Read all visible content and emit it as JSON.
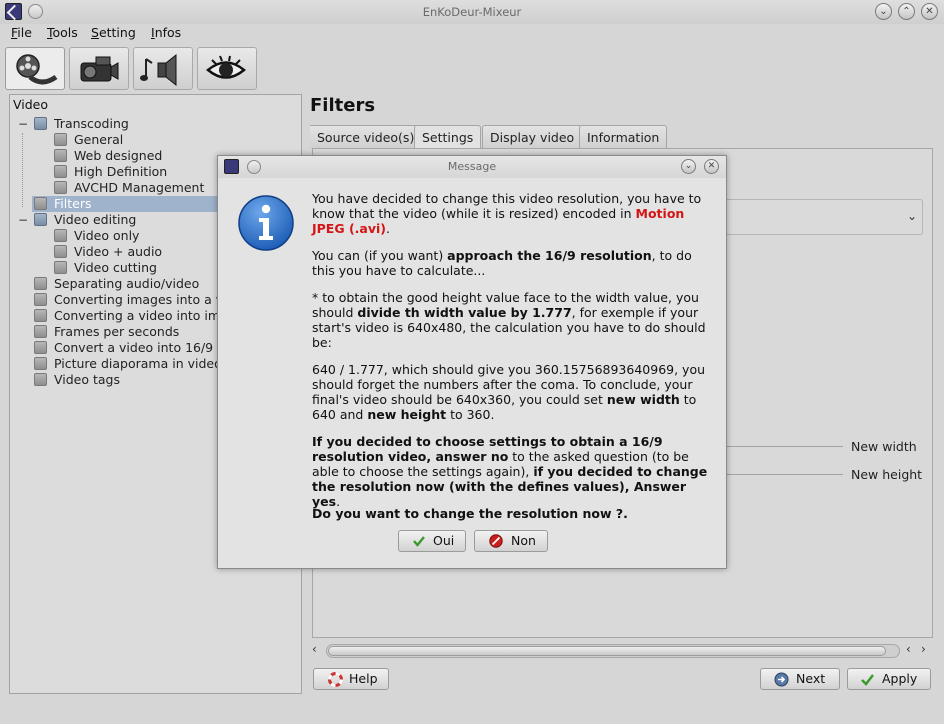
{
  "window": {
    "title": "EnKoDeur-Mixeur"
  },
  "menu": {
    "items": [
      "File",
      "Tools",
      "Setting",
      "Infos"
    ]
  },
  "toolbar": {
    "buttons": [
      "video-film-icon",
      "camera-icon",
      "audio-speaker-icon",
      "eye-icon"
    ]
  },
  "sidebar": {
    "header": "Video",
    "tree": [
      {
        "label": "Transcoding"
      },
      {
        "label": "General"
      },
      {
        "label": "Web designed"
      },
      {
        "label": "High Definition"
      },
      {
        "label": "AVCHD Management"
      },
      {
        "label": "Filters"
      },
      {
        "label": "Video editing"
      },
      {
        "label": "Video only"
      },
      {
        "label": "Video + audio"
      },
      {
        "label": "Video cutting"
      },
      {
        "label": "Separating audio/video"
      },
      {
        "label": "Converting images into a v"
      },
      {
        "label": "Converting a video into ima"
      },
      {
        "label": "Frames per seconds"
      },
      {
        "label": "Convert a video into 16/9 d"
      },
      {
        "label": "Picture diaporama in video"
      },
      {
        "label": "Video tags"
      }
    ],
    "toggle_collapse": "−"
  },
  "main": {
    "title": "Filters",
    "tabs": [
      "Source video(s)",
      "Settings",
      "Display video",
      "Information"
    ],
    "labels": {
      "new_width": "New width",
      "new_height": "New height"
    }
  },
  "buttons": {
    "help": "Help",
    "next": "Next",
    "apply": "Apply"
  },
  "dialog": {
    "title": "Message",
    "p1_a": "You have decided to change this video resolution, you have to know that the video (while it is resized) encoded in ",
    "p1_b": "Motion JPEG (.avi)",
    "p1_c": ".",
    "p2_a": "You can (if you want) ",
    "p2_b": "approach the 16/9 resolution",
    "p2_c": ", to do this you have to calculate...",
    "p3_a": "* to obtain the good height value face to the width value, you should ",
    "p3_b": "divide th width value by 1.777",
    "p3_c": ", for exemple if your start's video is 640x480, the calculation you have to do should be:",
    "p4_a": "640 / 1.777, which should give you 360.15756893640969, you should forget the numbers after the coma. To conclude, your final's video should be 640x360, you could set ",
    "p4_b": "new width",
    "p4_c": " to 640 and ",
    "p4_d": "new height",
    "p4_e": " to 360.",
    "p5_a": "If you decided to choose settings to obtain a 16/9 resolution video, answer no",
    "p5_b": " to the asked question (to be able to choose the settings again), ",
    "p5_c": "if you decided to change the resolution now (with the defines values), Answer yes",
    "p5_d": ".",
    "p6": "Do you want to change the resolution now ?.",
    "yes": "Oui",
    "no": "Non"
  },
  "colors": {
    "selection": "#9fb3cc",
    "accent_red": "#d41515",
    "info_blue": "#1f5fb8"
  }
}
